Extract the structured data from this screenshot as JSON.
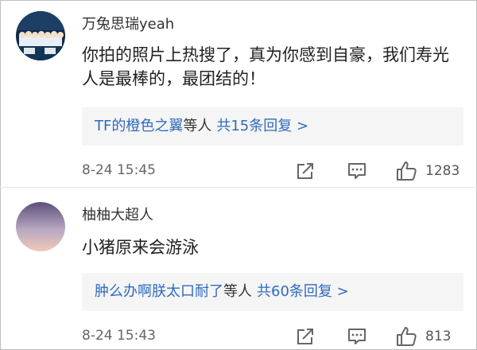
{
  "comments": [
    {
      "username": "万兔思瑞yeah",
      "text": "你拍的照片上热搜了，真为你感到自豪，我们寿光人是最棒的，最团结的！",
      "reply_users": "TF的橙色之翼",
      "reply_suffix": "等人",
      "reply_count": "共15条回复 >",
      "timestamp": "8-24 15:45",
      "likes": "1283",
      "avatar_icon": "group-photo-avatar"
    },
    {
      "username": "柚柚大超人",
      "text": "小猪原来会游泳",
      "reply_users": "肿么办啊朕太口耐了",
      "reply_suffix": "等人",
      "reply_count": "共60条回复 >",
      "timestamp": "8-24 15:43",
      "likes": "813",
      "avatar_icon": "sky-gradient-avatar"
    }
  ],
  "colors": {
    "link": "#2f6bbd",
    "reply_bg": "#f5f5f5",
    "icon": "#666666"
  },
  "icons": [
    "share-icon",
    "comment-icon",
    "like-icon"
  ]
}
